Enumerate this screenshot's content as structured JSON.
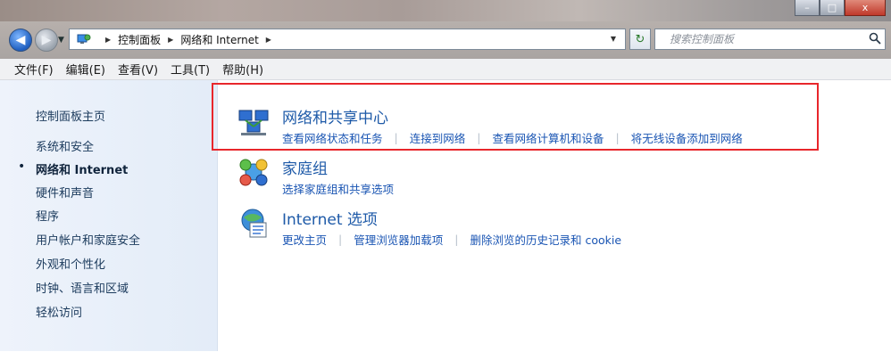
{
  "titlebar": {
    "min": "–",
    "max": "□",
    "close": "x"
  },
  "address": {
    "crumbs": [
      "控制面板",
      "网络和 Internet"
    ],
    "search_placeholder": "搜索控制面板"
  },
  "menu": [
    "文件(F)",
    "编辑(E)",
    "查看(V)",
    "工具(T)",
    "帮助(H)"
  ],
  "sidebar": {
    "home": "控制面板主页",
    "items": [
      "系统和安全",
      "网络和 Internet",
      "硬件和声音",
      "程序",
      "用户帐户和家庭安全",
      "外观和个性化",
      "时钟、语言和区域",
      "轻松访问"
    ],
    "current_index": 1
  },
  "categories": [
    {
      "title": "网络和共享中心",
      "icon": "network-sharing-icon",
      "links": [
        "查看网络状态和任务",
        "连接到网络",
        "查看网络计算机和设备",
        "将无线设备添加到网络"
      ]
    },
    {
      "title": "家庭组",
      "icon": "homegroup-icon",
      "links": [
        "选择家庭组和共享选项"
      ]
    },
    {
      "title": "Internet 选项",
      "icon": "internet-options-icon",
      "links": [
        "更改主页",
        "管理浏览器加载项",
        "删除浏览的历史记录和 cookie"
      ]
    }
  ],
  "colors": {
    "highlight": "#e8262b",
    "link": "#1a55b3",
    "category_title": "#1e5aa8"
  }
}
